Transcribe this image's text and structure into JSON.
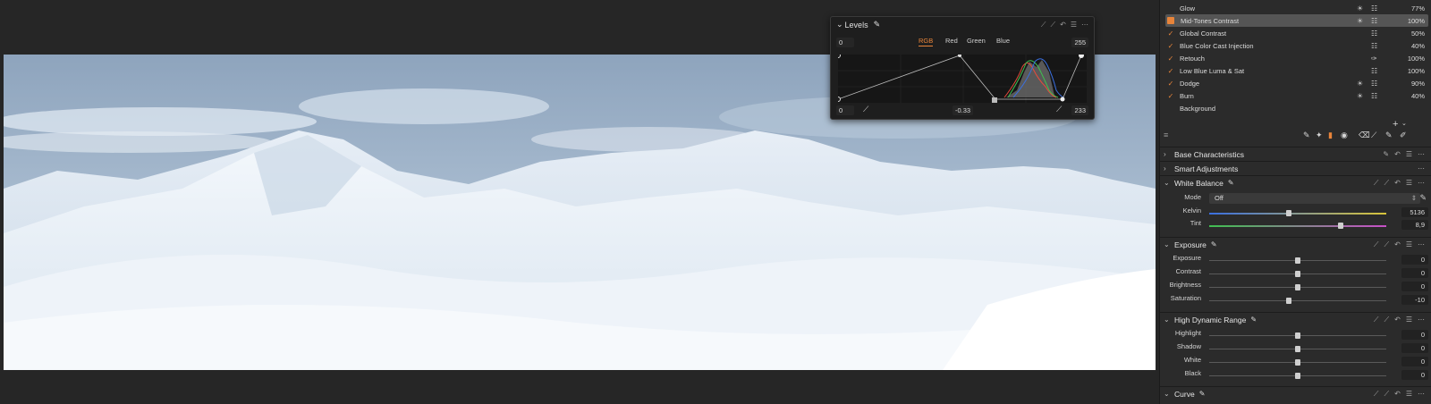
{
  "levels": {
    "title": "Levels",
    "tabs": [
      "RGB",
      "Red",
      "Green",
      "Blue"
    ],
    "active_tab": "RGB",
    "output_low": "0",
    "output_high": "255",
    "input_low": "0",
    "midtone": "-0.33",
    "input_high": "233",
    "colors": {
      "red": "#e74b3c",
      "green": "#3fbf50",
      "blue": "#3a6fe0",
      "orange": "#e8843a"
    }
  },
  "layers": [
    {
      "name": "Glow",
      "checked": false,
      "icons": [
        "brightness-icon",
        "sliders-icon"
      ],
      "pct": "77%"
    },
    {
      "name": "Mid-Tones Contrast",
      "checked": true,
      "selected": true,
      "icons": [
        "brightness-icon",
        "sliders-icon"
      ],
      "pct": "100%"
    },
    {
      "name": "Global Contrast",
      "checked": true,
      "icons": [
        "sliders-icon"
      ],
      "pct": "50%"
    },
    {
      "name": "Blue Color Cast Injection",
      "checked": true,
      "icons": [
        "sliders-icon"
      ],
      "pct": "40%"
    },
    {
      "name": "Retouch",
      "checked": true,
      "icons": [
        "bandage-icon"
      ],
      "pct": "100%"
    },
    {
      "name": "Low Blue Luma & Sat",
      "checked": true,
      "icons": [
        "sliders-icon"
      ],
      "pct": "100%"
    },
    {
      "name": "Dodge",
      "checked": true,
      "icons": [
        "brightness-icon",
        "sliders-icon"
      ],
      "pct": "90%"
    },
    {
      "name": "Burn",
      "checked": true,
      "icons": [
        "brightness-icon",
        "sliders-icon"
      ],
      "pct": "40%"
    },
    {
      "name": "Background",
      "checked": false,
      "icons": [],
      "pct": ""
    }
  ],
  "add_layer": "+",
  "sections": {
    "base": "Base Characteristics",
    "smart": "Smart Adjustments",
    "wb": "White Balance",
    "exposure": "Exposure",
    "hdr": "High Dynamic Range",
    "curve": "Curve"
  },
  "white_balance": {
    "mode_label": "Mode",
    "mode_value": "Off",
    "kelvin_label": "Kelvin",
    "kelvin_value": "5136",
    "kelvin_level": 0.45,
    "tint_label": "Tint",
    "tint_value": "8,9",
    "tint_level": 0.74
  },
  "exposure": [
    {
      "label": "Exposure",
      "value": "0",
      "level": 0.5
    },
    {
      "label": "Contrast",
      "value": "0",
      "level": 0.5
    },
    {
      "label": "Brightness",
      "value": "0",
      "level": 0.5
    },
    {
      "label": "Saturation",
      "value": "-10",
      "level": 0.45
    }
  ],
  "hdr": [
    {
      "label": "Highlight",
      "value": "0",
      "level": 0.5
    },
    {
      "label": "Shadow",
      "value": "0",
      "level": 0.5
    },
    {
      "label": "White",
      "value": "0",
      "level": 0.5
    },
    {
      "label": "Black",
      "value": "0",
      "level": 0.5
    }
  ]
}
